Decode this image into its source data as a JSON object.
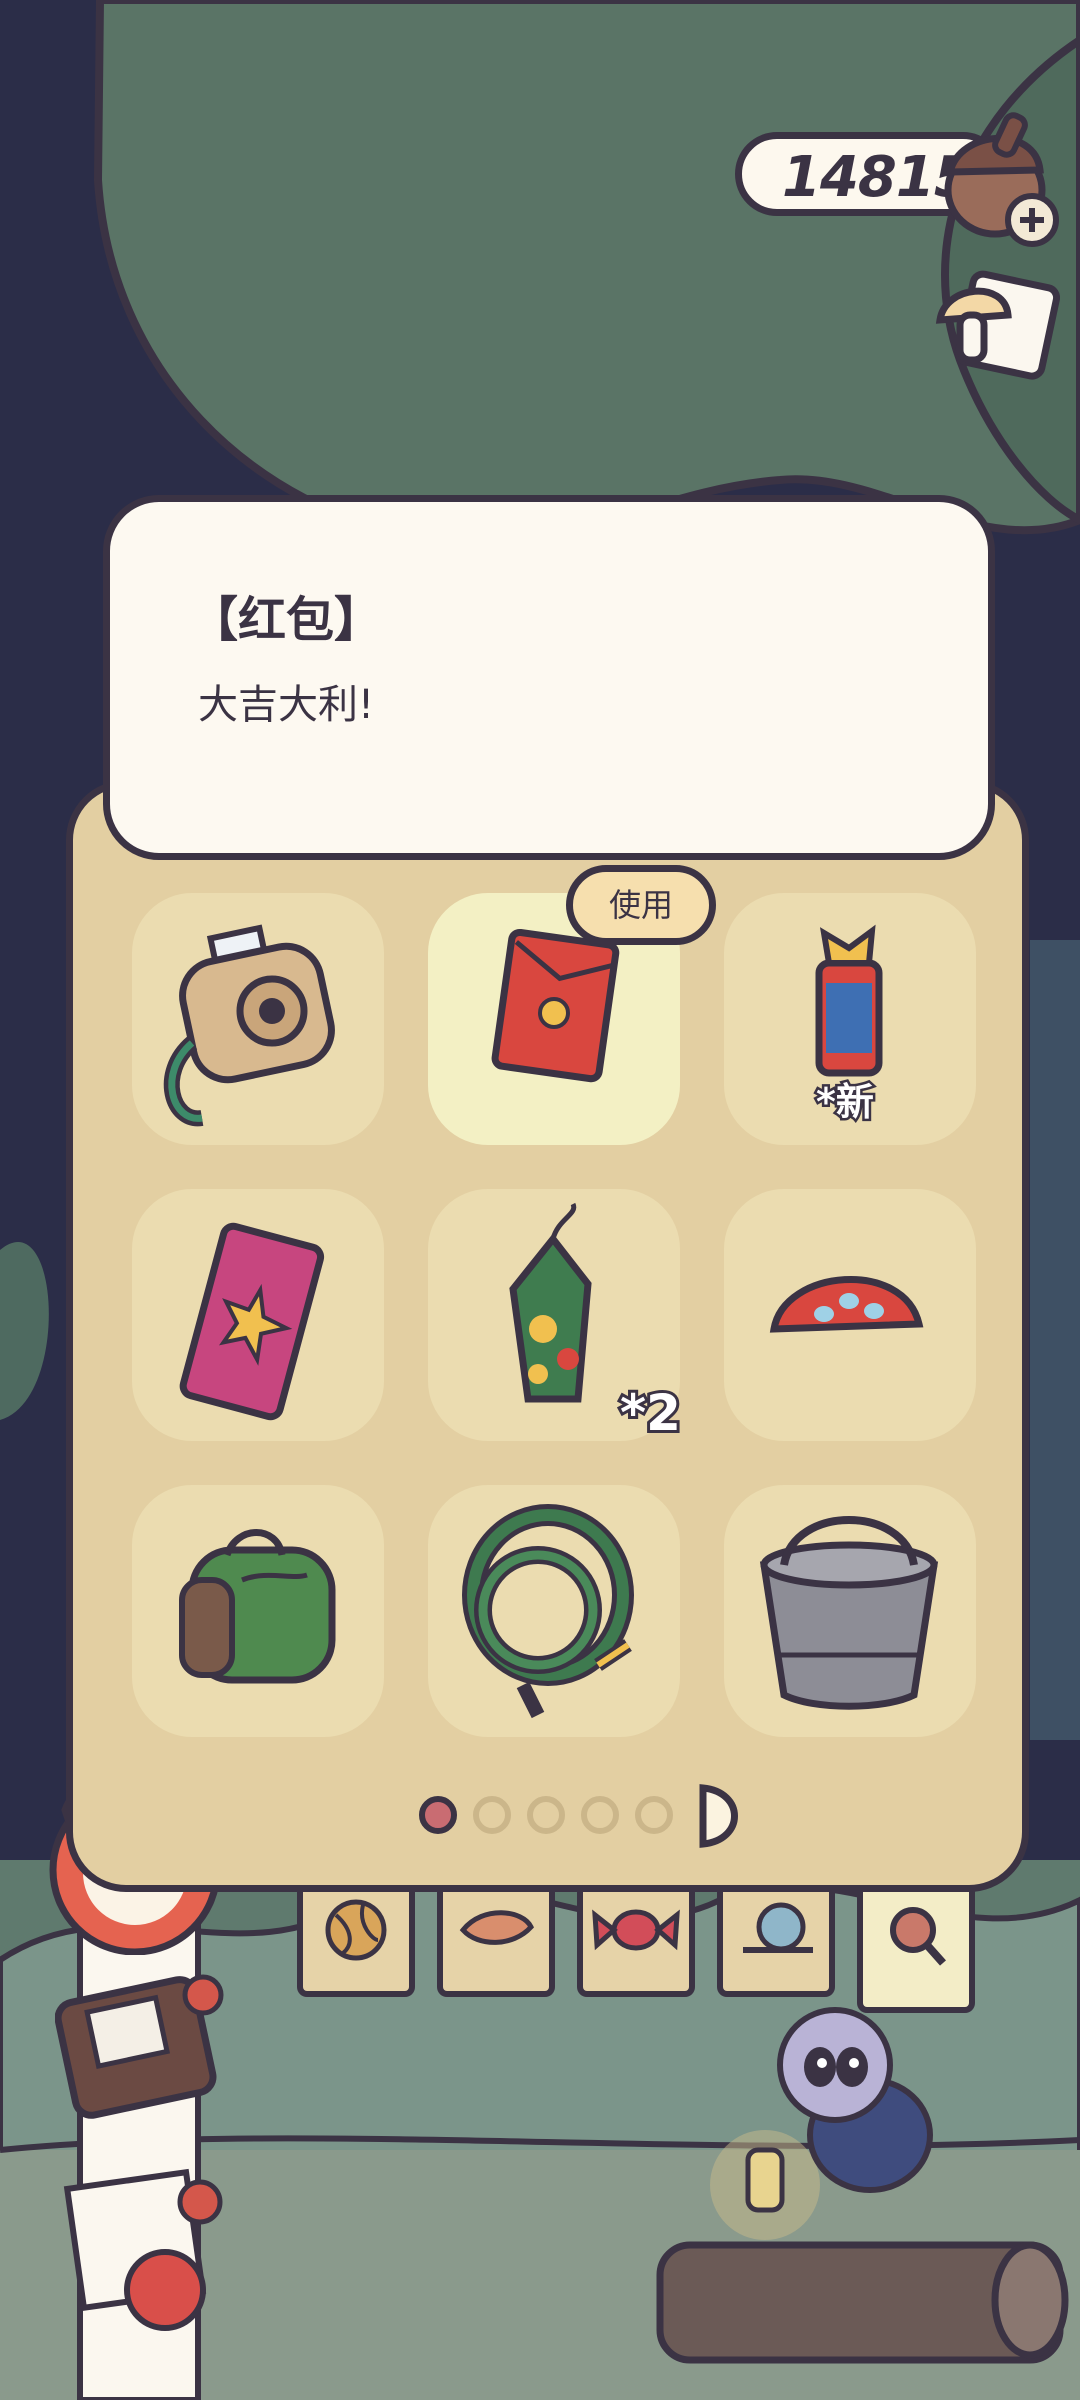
{
  "currency": {
    "amount": "14815"
  },
  "description": {
    "title": "【红包】",
    "text": "大吉大利!"
  },
  "use_button_label": "使用",
  "inventory": {
    "items": [
      {
        "name": "camera",
        "count": ""
      },
      {
        "name": "red-envelope",
        "count": "",
        "selected": true
      },
      {
        "name": "firecracker-candy",
        "count": "*新"
      },
      {
        "name": "fireworks-box",
        "count": ""
      },
      {
        "name": "lantern-firework",
        "count": "*2"
      },
      {
        "name": "dumpling-fan",
        "count": ""
      },
      {
        "name": "backpack",
        "count": ""
      },
      {
        "name": "rope",
        "count": ""
      },
      {
        "name": "bucket",
        "count": ""
      }
    ],
    "page": {
      "current": 1,
      "total": 5
    }
  },
  "category_tabs": [
    "yarn-icon",
    "leaf-icon",
    "candy-icon",
    "snail-icon",
    "magnifier-icon"
  ],
  "colors": {
    "outline": "#3b3344",
    "panel": "#e3cfa2",
    "card": "#fdf9f1",
    "accent": "#c96c72"
  }
}
